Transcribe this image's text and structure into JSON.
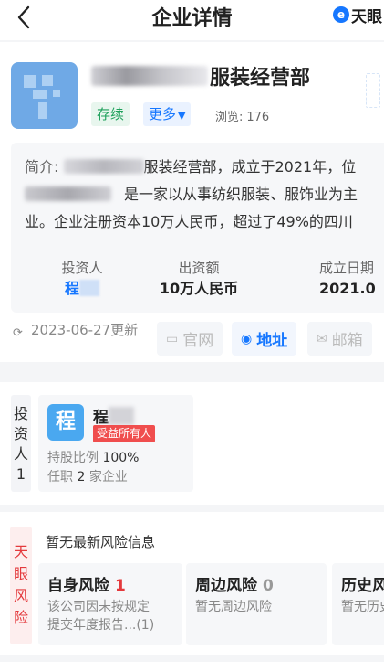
{
  "header": {
    "title": "企业详情",
    "brand": "天眼",
    "brand_icon": "tianyan-logo-icon"
  },
  "company": {
    "name_suffix": "服装经营部",
    "status": "存续",
    "more": "更多",
    "views_label": "浏览:",
    "views_count": "176",
    "intro_label": "简介:",
    "intro_1": "服装经营部，成立于2021年，位",
    "intro_2": "是一家以从事纺织服装、服饰业为主",
    "intro_3": "业。企业注册资本10万人民币，超过了49%的四川"
  },
  "stats": [
    {
      "label": "投资人",
      "value": "程"
    },
    {
      "label": "出资额",
      "value": "10万人民币"
    },
    {
      "label": "成立日期",
      "value": "2021.0"
    }
  ],
  "update": {
    "time": "2023-06-27更新"
  },
  "links": {
    "website": "官网",
    "address": "地址",
    "email": "邮箱"
  },
  "investors": {
    "section_label": "投资人",
    "count": "1",
    "avatar_char": "程",
    "name": "程",
    "tag": "受益所有人",
    "ratio_label": "持股比例",
    "ratio_value": "100%",
    "job_prefix": "任职",
    "job_count": "2",
    "job_suffix": "家企业"
  },
  "risk": {
    "section_label": "天眼风险",
    "head": "暂无最新风险信息",
    "cards": [
      {
        "title": "自身风险",
        "count": "1",
        "desc_1": "该公司因未按规定",
        "desc_2": "提交年度报告...(1)"
      },
      {
        "title": "周边风险",
        "count": "0",
        "desc_1": "暂无周边风险",
        "desc_2": ""
      },
      {
        "title": "历史风险",
        "count": "",
        "desc_1": "暂无历史风险",
        "desc_2": ""
      }
    ]
  },
  "colors": {
    "accent": "#1677ff",
    "status_green": "#1ea05b",
    "risk_red": "#e4393c"
  }
}
